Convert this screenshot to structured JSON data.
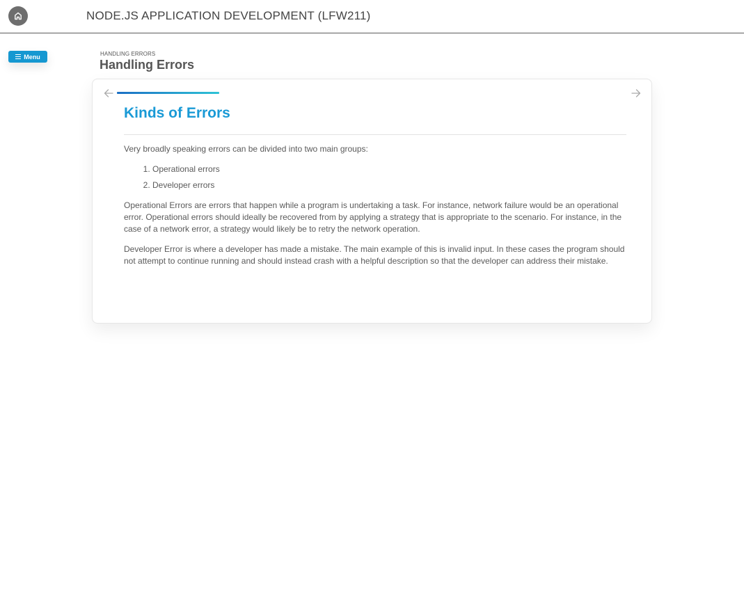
{
  "header": {
    "home_icon": "home-icon",
    "course_title": "NODE.JS APPLICATION DEVELOPMENT (LFW211)"
  },
  "menu": {
    "label": "Menu",
    "icon": "hamburger-icon",
    "color": "#1698d1"
  },
  "breadcrumb": "HANDLING ERRORS",
  "page_title": "Handling Errors",
  "card": {
    "prev_icon": "arrow-left-icon",
    "next_icon": "arrow-right-icon",
    "section_title": "Kinds of Errors",
    "title_color": "#1a9ad6",
    "intro": "Very broadly speaking errors can be divided into two main groups:",
    "groups": [
      "Operational errors",
      "Developer errors"
    ],
    "paragraph_operational": "Operational Errors are errors that happen while a program is undertaking a task. For instance, network failure would be an operational error. Operational errors should ideally be recovered from by applying a strategy that is appropriate to the scenario. For instance, in the case of a network error, a strategy would likely be to retry the network operation.",
    "paragraph_developer": "Developer Error is where a developer has made a mistake. The main example of this is invalid input. In these cases the program should not attempt to continue running and should instead crash with a helpful description so that the developer can address their mistake."
  }
}
